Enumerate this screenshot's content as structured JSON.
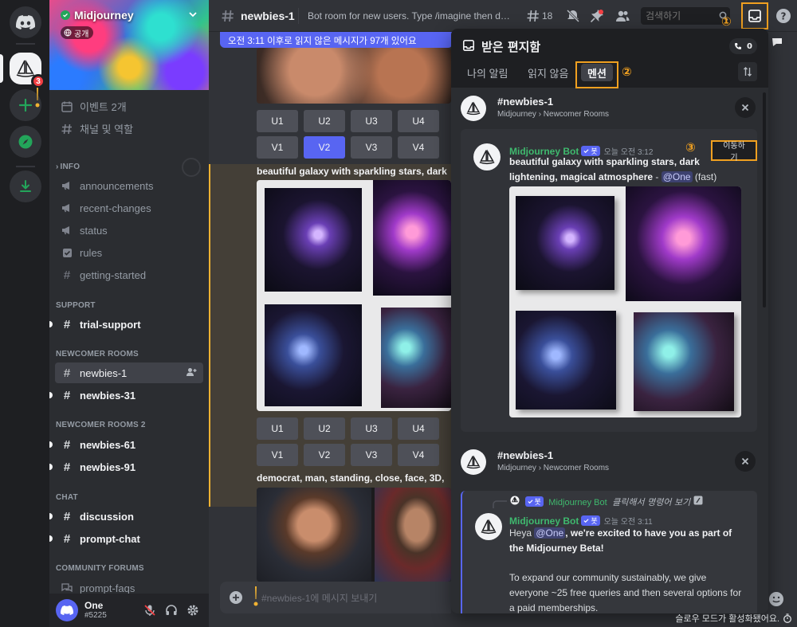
{
  "server": {
    "name": "Midjourney",
    "visibility": "공개",
    "notification_count": "3"
  },
  "sidebar": {
    "top_items": [
      {
        "label": "이벤트 2개"
      },
      {
        "label": "채널 및 역할"
      }
    ],
    "categories": [
      {
        "label": "INFO"
      },
      {
        "label": "SUPPORT"
      },
      {
        "label": "NEWCOMER ROOMS"
      },
      {
        "label": "NEWCOMER ROOMS 2"
      },
      {
        "label": "CHAT"
      },
      {
        "label": "COMMUNITY FORUMS"
      }
    ],
    "channels": [
      {
        "label": "announcements"
      },
      {
        "label": "recent-changes"
      },
      {
        "label": "status"
      },
      {
        "label": "rules"
      },
      {
        "label": "getting-started"
      },
      {
        "label": "trial-support"
      },
      {
        "label": "newbies-1"
      },
      {
        "label": "newbies-31"
      },
      {
        "label": "newbies-61"
      },
      {
        "label": "newbies-91"
      },
      {
        "label": "discussion"
      },
      {
        "label": "prompt-chat"
      },
      {
        "label": "prompt-faqs"
      }
    ]
  },
  "user": {
    "name": "One",
    "tag": "#5225"
  },
  "topbar": {
    "channel": "newbies-1",
    "topic": "Bot room for new users. Type /imagine then descri...",
    "threads_count": "18",
    "search_placeholder": "검색하기"
  },
  "new_messages_bar": "오전 3:11 이후로 읽지 않은 메시지가 97개 있어요",
  "chat": {
    "upscale_buttons": [
      "U1",
      "U2",
      "U3",
      "U4"
    ],
    "variation_buttons": [
      "V1",
      "V2",
      "V3",
      "V4"
    ],
    "prompt_1": "beautiful galaxy with sparkling stars, dark",
    "prompt_2": "democrat, man, standing, close, face, 3D,",
    "composer_placeholder": "#newbies-1에 메시지 보내기"
  },
  "inbox": {
    "title": "받은 편지함",
    "call_count": "0",
    "tabs": [
      {
        "label": "나의 알림"
      },
      {
        "label": "읽지 않음"
      },
      {
        "label": "멘션"
      }
    ],
    "groups": [
      {
        "channel": "#newbies-1",
        "sub": "Midjourney › Newcomer Rooms",
        "author": "Midjourney Bot",
        "bot_tag": "봇",
        "time": "오늘 오전 3:12",
        "jump_label": "이동하기",
        "text_bold": "beautiful galaxy with sparkling stars, dark lightening, magical atmosphere",
        "text_sep": " - ",
        "mention": "@One",
        "text_tail": " (fast)"
      },
      {
        "channel": "#newbies-1",
        "sub": "Midjourney › Newcomer Rooms",
        "reply_author": "Midjourney Bot",
        "reply_bot_tag": "봇",
        "reply_text": "클릭해서 명령어 보기",
        "author": "Midjourney Bot",
        "bot_tag": "봇",
        "time": "오늘 오전 3:11",
        "p1_head": "Heya ",
        "mention": "@One",
        "p1_tail": ", we're excited to have you as part of the Midjourney Beta!",
        "p2": "To expand our community sustainably, we give everyone ~25 free queries and then several options for a paid memberships."
      }
    ]
  },
  "callouts": [
    "①",
    "②",
    "③"
  ],
  "status_text": "슬로우 모드가 활성화됐어요.",
  "colors": {
    "accent": "#5865f2",
    "callout": "#f0a020",
    "bot_name": "#3fb96e",
    "danger": "#f23f43"
  }
}
